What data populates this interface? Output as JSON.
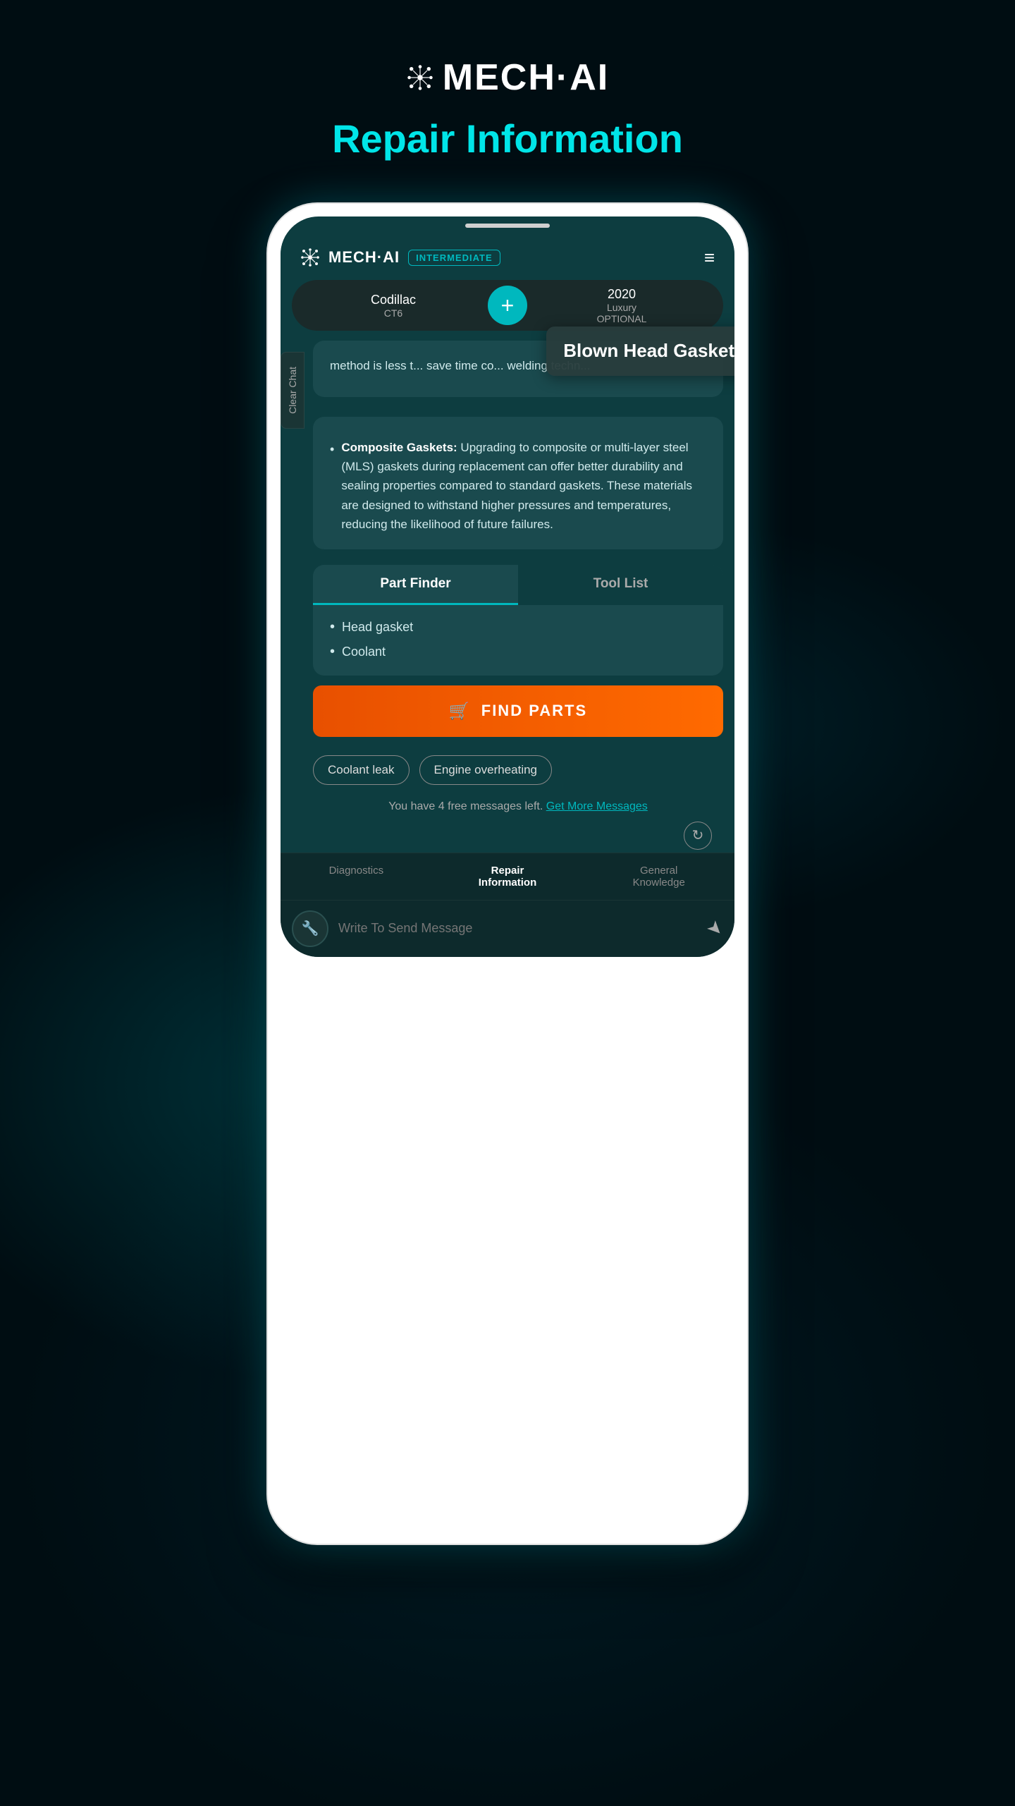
{
  "brand": {
    "name": "MECH·AI",
    "page_title": "Repair Information",
    "logo_icon": "⚙"
  },
  "app": {
    "name": "MECH·AI",
    "level_badge": "INTERMEDIATE",
    "hamburger": "≡"
  },
  "vehicle": {
    "make": "Codillac",
    "model": "CT6",
    "year": "2020",
    "trim": "Luxury",
    "option": "OPTIONAL",
    "add_button": "+"
  },
  "sidebar": {
    "clear_chat": "Clear Chat"
  },
  "tooltip": {
    "text": "Blown Head Gasket"
  },
  "chat": {
    "truncated": "method is less t... save time co... welding techn...",
    "composite_title": "Composite",
    "composite_rest": " Gaskets:",
    "composite_body": " Upgrading to composite or multi-layer steel (MLS) gaskets during replacement can offer better durability and sealing properties compared to standard gaskets. These materials are designed to withstand higher pressures and temperatures, reducing the likelihood of future failures."
  },
  "parts": {
    "tab_parts": "Part Finder",
    "tab_tools": "Tool List",
    "parts_list": [
      "Head gasket",
      "Coolant"
    ],
    "find_button": "FIND PARTS"
  },
  "suggestions": {
    "chip1": "Coolant leak",
    "chip2": "Engine overheating"
  },
  "messages": {
    "free_text": "You have 4 free messages left.",
    "get_more": "Get More Messages"
  },
  "nav": {
    "diagnostics": "Diagnostics",
    "repair": "Repair\nInformation",
    "general": "General\nKnowledge"
  },
  "input": {
    "placeholder": "Write To Send Message"
  }
}
